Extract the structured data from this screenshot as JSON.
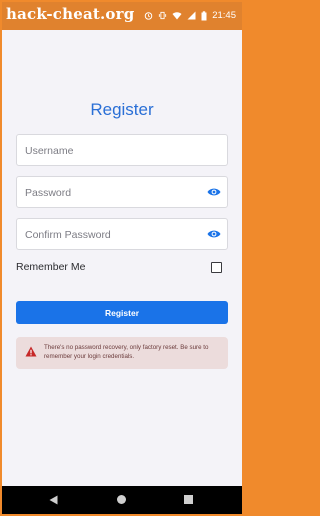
{
  "status_bar": {
    "watermark": "hack-cheat.org",
    "time": "21:45",
    "icons": [
      "alarm-icon",
      "vibrate-icon",
      "wifi-icon",
      "cellular-icon",
      "battery-icon"
    ]
  },
  "form": {
    "title": "Register",
    "username_placeholder": "Username",
    "password_placeholder": "Password",
    "confirm_password_placeholder": "Confirm Password",
    "remember_me_label": "Remember Me",
    "remember_me_checked": false,
    "register_button_label": "Register"
  },
  "warning": {
    "text": "There's no password recovery, only factory reset. Be sure to remember your login credentials."
  },
  "colors": {
    "accent": "#1a73e8",
    "title": "#2a6fd6",
    "status_bar": "#e0822e",
    "warning_bg": "#ecdcdc",
    "warning_icon": "#c62828"
  },
  "nav_bar": {
    "icons": [
      "back-icon",
      "home-icon",
      "recents-icon"
    ]
  }
}
